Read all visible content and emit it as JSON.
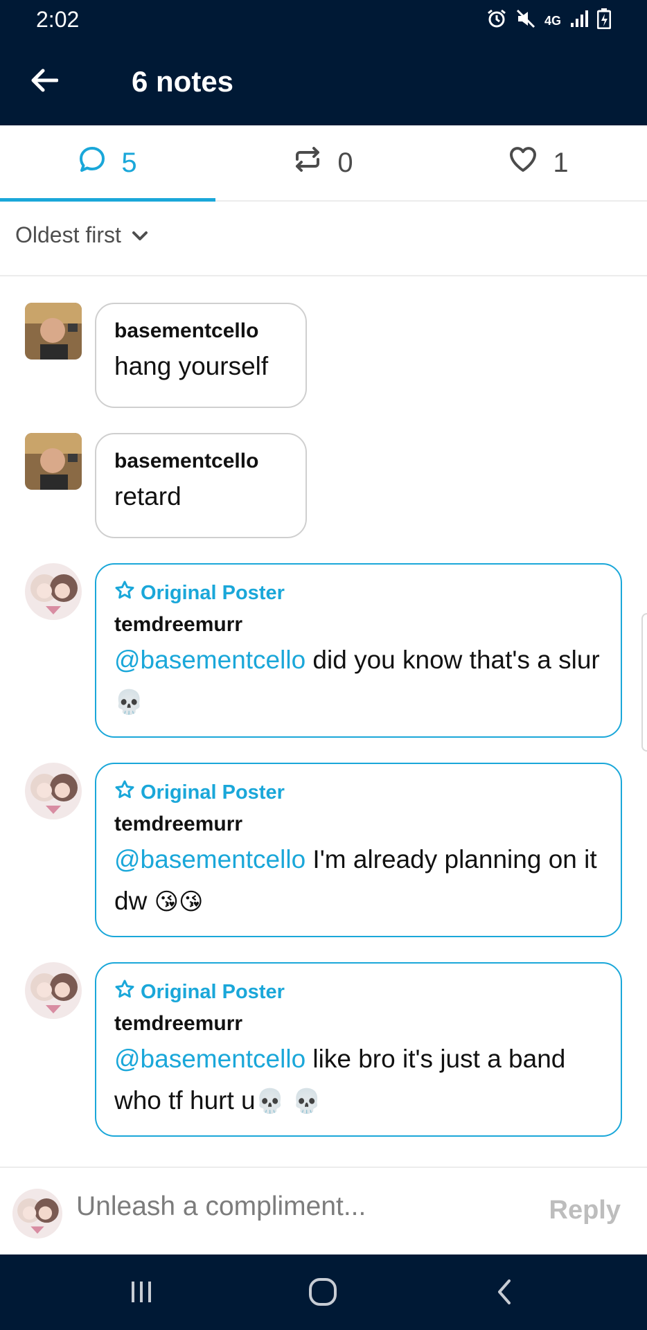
{
  "status_bar": {
    "time": "2:02",
    "icons": [
      "alarm-icon",
      "mute-icon",
      "4g-icon",
      "signal-icon",
      "battery-icon"
    ],
    "network_label": "4G"
  },
  "header": {
    "title": "6 notes",
    "back_icon": "arrow-left-icon"
  },
  "tabs": [
    {
      "name": "comments",
      "icon": "speech-bubble-icon",
      "count": "5",
      "active": true
    },
    {
      "name": "reblogs",
      "icon": "reblog-icon",
      "count": "0",
      "active": false
    },
    {
      "name": "likes",
      "icon": "heart-icon",
      "count": "1",
      "active": false
    }
  ],
  "sort": {
    "label": "Oldest first",
    "icon": "chevron-down-icon"
  },
  "comments": [
    {
      "username": "basementcello",
      "op": false,
      "mention": "",
      "text": "hang yourself",
      "emoji": ""
    },
    {
      "username": "basementcello",
      "op": false,
      "mention": "",
      "text": "retard",
      "emoji": ""
    },
    {
      "username": "temdreemurr",
      "op": true,
      "op_label": "Original Poster",
      "mention": "@basementcello",
      "text": " did you know that's a slur ",
      "emoji": "💀"
    },
    {
      "username": "temdreemurr",
      "op": true,
      "op_label": "Original Poster",
      "mention": "@basementcello",
      "text": " I'm already planning on it dw ",
      "emoji": "😘😘"
    },
    {
      "username": "temdreemurr",
      "op": true,
      "op_label": "Original Poster",
      "mention": "@basementcello",
      "text": " like bro it's just a band who tf hurt u",
      "emoji": "💀 💀"
    }
  ],
  "composer": {
    "placeholder": "Unleash a compliment...",
    "reply_label": "Reply"
  },
  "nav_bar": {
    "buttons": [
      "recent-apps-icon",
      "home-icon",
      "back-icon"
    ]
  },
  "colors": {
    "navy": "#001935",
    "accent": "#1aa7d9",
    "bubble_border": "#cfcfcf",
    "reply_disabled": "#bdbdbd"
  }
}
